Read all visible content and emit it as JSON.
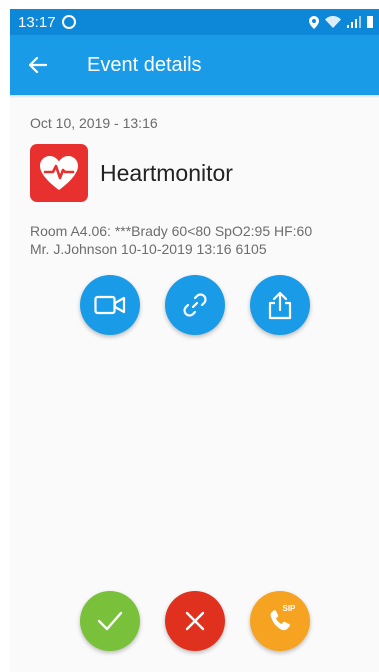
{
  "status_bar": {
    "time": "13:17"
  },
  "app_bar": {
    "title": "Event details"
  },
  "event": {
    "date": "Oct 10, 2019 - 13:16",
    "app_name": "Heartmonitor",
    "message_line1": "Room A4.06: ***Brady 60<80 SpO2:95 HF:60",
    "message_line2": "Mr. J.Johnson 10-10-2019 13:16 6105"
  },
  "actions": [
    {
      "icon": "video-camera-icon"
    },
    {
      "icon": "link-icon"
    },
    {
      "icon": "share-icon"
    }
  ],
  "bottom_actions": {
    "accept_icon": "checkmark-icon",
    "reject_icon": "close-icon",
    "sip_label": "SIP"
  },
  "colors": {
    "status_bar": "#0d87d8",
    "app_bar": "#1a9be8",
    "accent_blue": "#1a9be8",
    "accept": "#79c13a",
    "reject": "#e0311f",
    "sip": "#f5a321",
    "app_icon_bg": "#e8312f"
  }
}
